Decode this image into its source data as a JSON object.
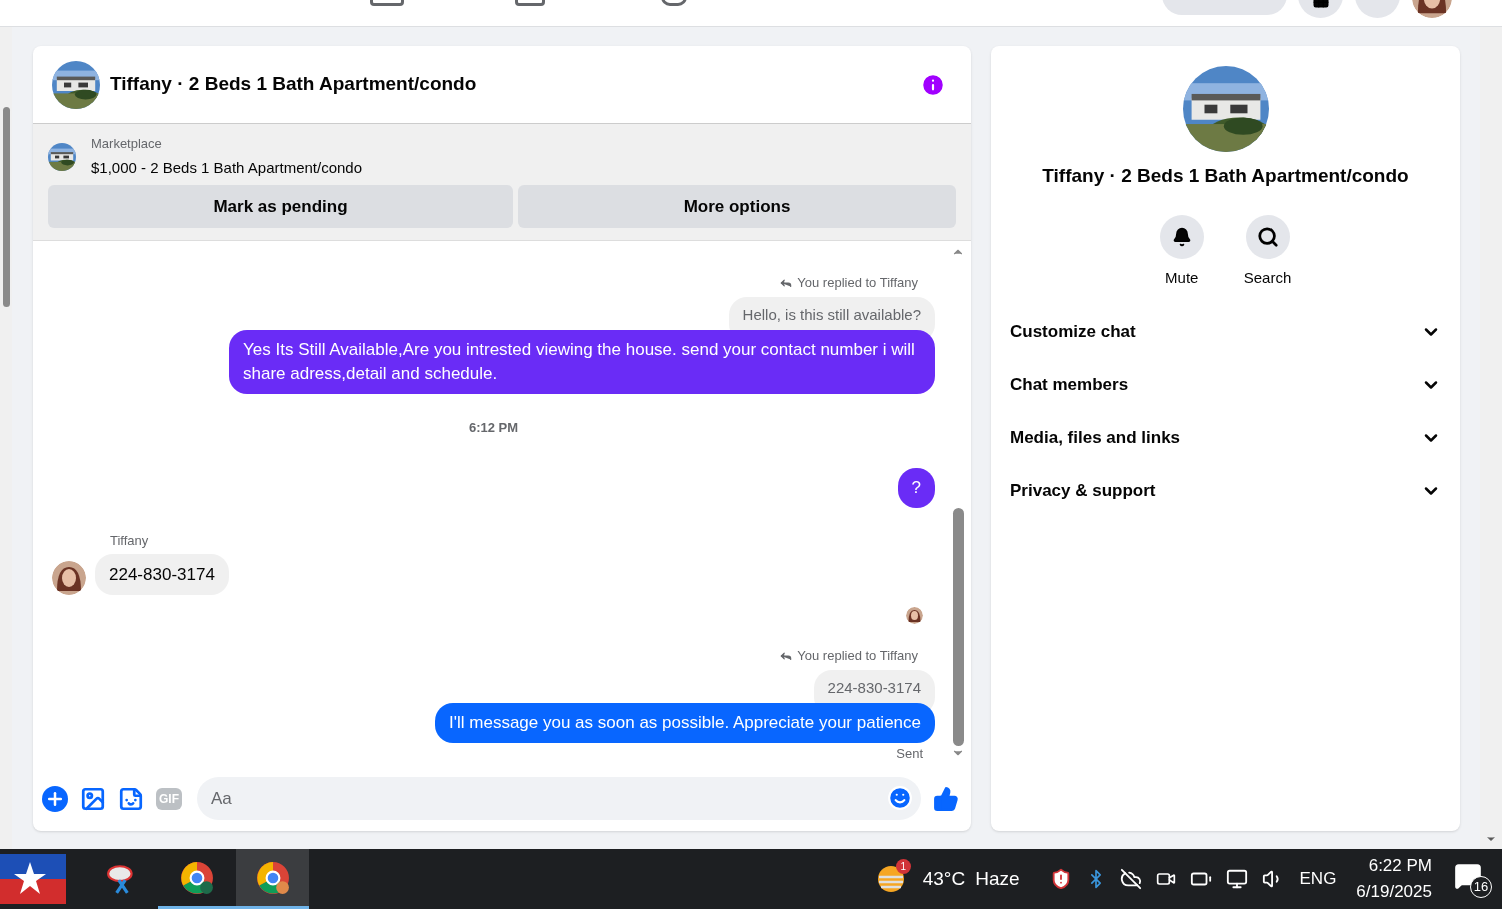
{
  "conversation": {
    "title": "Tiffany · 2 Beds 1 Bath Apartment/condo"
  },
  "listing": {
    "source": "Marketplace",
    "summary": "$1,000 - 2 Beds 1 Bath Apartment/condo",
    "actions": [
      "Mark as pending",
      "More options"
    ]
  },
  "messages": [
    {
      "kind": "reply_note",
      "text": "You replied to Tiffany"
    },
    {
      "kind": "quoted",
      "text": "Hello, is this still available?"
    },
    {
      "kind": "outgoing",
      "text": "Yes Its Still Available,Are you intrested viewing the house. send your contact number i will share adress,detail and schedule.",
      "color": "#6a2cf6"
    },
    {
      "kind": "timestamp",
      "text": "6:12 PM"
    },
    {
      "kind": "outgoing",
      "text": "?",
      "color": "#6a2cf6"
    },
    {
      "kind": "sender",
      "text": "Tiffany"
    },
    {
      "kind": "incoming",
      "text": "224-830-3174"
    },
    {
      "kind": "seen"
    },
    {
      "kind": "reply_note",
      "text": "You replied to Tiffany"
    },
    {
      "kind": "quoted",
      "text": "224-830-3174"
    },
    {
      "kind": "outgoing",
      "text": "I'll message you as soon as possible. Appreciate your patience",
      "color": "#0866ff"
    },
    {
      "kind": "status",
      "text": "Sent"
    }
  ],
  "composer": {
    "placeholder": "Aa",
    "gif_label": "GIF"
  },
  "details": {
    "title": "Tiffany · 2 Beds 1 Bath Apartment/condo",
    "actions": [
      {
        "kind": "mute",
        "label": "Mute"
      },
      {
        "kind": "search",
        "label": "Search"
      }
    ],
    "sections": [
      {
        "label": "Customize chat",
        "expanded": false
      },
      {
        "label": "Chat members",
        "expanded": false
      },
      {
        "label": "Media, files and links",
        "expanded": false
      },
      {
        "label": "Privacy & support",
        "expanded": false
      }
    ]
  },
  "taskbar": {
    "weather_badge": "1",
    "temperature": "43°C",
    "condition": "Haze",
    "language": "ENG",
    "time": "6:22 PM",
    "date": "6/19/2025",
    "notifications": "16"
  }
}
